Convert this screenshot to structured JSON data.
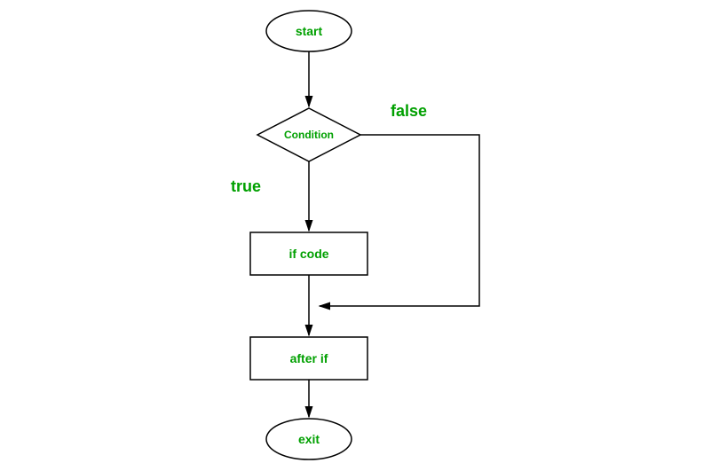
{
  "flowchart": {
    "start": "start",
    "condition": "Condition",
    "true_label": "true",
    "false_label": "false",
    "if_code": "if code",
    "after_if": "after if",
    "exit": "exit"
  }
}
